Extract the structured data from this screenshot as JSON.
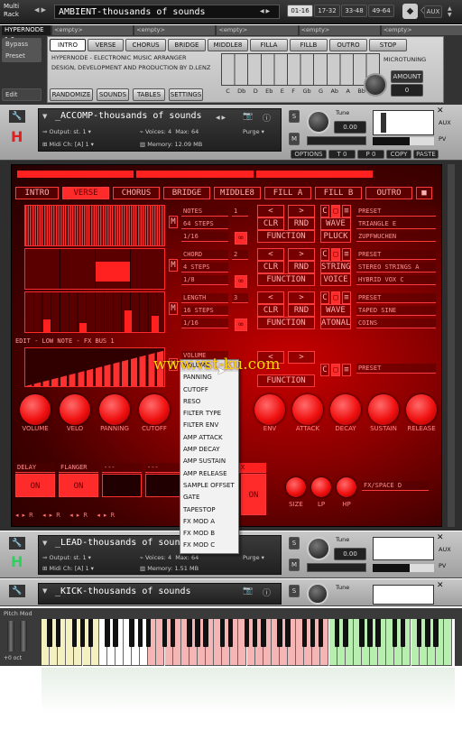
{
  "rack": {
    "multi": "Multi",
    "rack": "Rack",
    "title": "AMBIENT-thousands of sounds",
    "ranges": [
      "01-16",
      "17-32",
      "33-48",
      "49-64"
    ],
    "aux": "AUX"
  },
  "top": {
    "instrument": "HYPERNODE 1.0",
    "slots": [
      "<empty>",
      "<empty>",
      "<empty>",
      "<empty>",
      "<empty>"
    ],
    "bypass": "Bypass",
    "preset": "Preset",
    "edit": "Edit"
  },
  "hyper": {
    "tabs": [
      "INTRO",
      "VERSE",
      "CHORUS",
      "BRIDGE",
      "MIDDLE8",
      "FILLA",
      "FILLB",
      "OUTRO",
      "STOP"
    ],
    "line1": "HYPERNODE - ELECTRONIC MUSIC ARRANGER",
    "line2": "DESIGN, DEVELOPMENT AND PRODUCTION BY D.LENZ",
    "microtuning": "MICROTUNING",
    "amount": "AMOUNT",
    "amount_value": "0",
    "notes": [
      "C",
      "Db",
      "D",
      "Eb",
      "E",
      "F",
      "Gb",
      "G",
      "Ab",
      "A",
      "Bb",
      "B"
    ],
    "buttons": [
      "RANDOMIZE",
      "SOUNDS",
      "TABLES",
      "SETTINGS"
    ]
  },
  "inst1": {
    "title": "_ACCOMP-thousands of sounds",
    "output": "Output:",
    "output_val": "st. 1",
    "voices": "Voices:",
    "voices_val": "4",
    "max": "Max:",
    "max_val": "64",
    "purge": "Purge",
    "midi": "Midi Ch:",
    "midi_val": "[A]  1",
    "memory": "Memory:",
    "memory_val": "12.09 MB",
    "tune": "Tune",
    "tune_val": "0.00",
    "s": "S",
    "m": "M",
    "tabs": [
      "OPTIONS",
      "T 0",
      "P 0",
      "COPY",
      "PASTE"
    ]
  },
  "panel": {
    "sections": [
      "INTRO",
      "VERSE",
      "CHORUS",
      "BRIDGE",
      "MIDDLE8",
      "FILL A",
      "FILL B",
      "OUTRO"
    ],
    "rows": [
      {
        "sel1": "NOTES",
        "sel2": "64 STEPS",
        "sel3": "1/16",
        "num": "1",
        "b1": "CLR",
        "b2": "RND",
        "b3": "FUNCTION",
        "c1": "WAVE",
        "c2": "PLUCK",
        "p1": "PRESET",
        "p2": "TRIANGLE E",
        "p3": "ZUPFWUCHEN"
      },
      {
        "sel1": "CHORD",
        "sel2": "4 STEPS",
        "sel3": "1/8",
        "num": "2",
        "b1": "CLR",
        "b2": "RND",
        "b3": "FUNCTION",
        "c1": "STRING",
        "c2": "VOICE",
        "p1": "PRESET",
        "p2": "STEREO STRINGS A",
        "p3": "HYBRID VOX C"
      },
      {
        "sel1": "LENGTH",
        "sel2": "16 STEPS",
        "sel3": "1/16",
        "num": "3",
        "b1": "CLR",
        "b2": "RND",
        "b3": "FUNCTION",
        "c1": "WAVE",
        "c2": "ATONAL",
        "p1": "PRESET",
        "p2": "TAPED SINE",
        "p3": "COINS"
      }
    ],
    "edit_label": "EDIT - LOW NOTE - FX BUS 1",
    "vol_sel": "VOLUME",
    "vol_function": "FUNCTION",
    "vol_preset": "PRESET",
    "knobs": [
      "VOLUME",
      "VELO",
      "PANNING",
      "CUTOFF",
      "ENV",
      "ATTACK",
      "DECAY",
      "SUSTAIN",
      "RELEASE"
    ],
    "fx": [
      "DELAY",
      "FLANGER",
      "---",
      "---"
    ],
    "fx_on": "ON",
    "fx_on2": "ON",
    "fx_x": "X",
    "space": "FX/SPACE D",
    "space_knobs": [
      "SIZE",
      "LP",
      "HP"
    ]
  },
  "menu": {
    "items": [
      "VOLUME",
      "PANNING",
      "CUTOFF",
      "RESO",
      "FILTER TYPE",
      "FILTER ENV",
      "AMP ATTACK",
      "AMP DECAY",
      "AMP SUSTAIN",
      "AMP RELEASE",
      "SAMPLE OFFSET",
      "GATE",
      "TAPESTOP",
      "FX MOD A",
      "FX MOD B",
      "FX MOD C"
    ]
  },
  "watermark": "www.vst-ku.com",
  "inst2": {
    "title": "_LEAD-thousands of sounds",
    "output": "Output:",
    "output_val": "st. 1",
    "voices": "Voices:",
    "voices_val": "4",
    "max": "Max:",
    "max_val": "64",
    "purge": "Purge",
    "midi": "Midi Ch:",
    "midi_val": "[A]  1",
    "memory": "Memory:",
    "memory_val": "1.51 MB",
    "tune": "Tune",
    "tune_val": "0.00",
    "s": "S",
    "m": "M"
  },
  "inst3": {
    "title": "_KICK-thousands of sounds",
    "tune": "Tune",
    "s": "S"
  },
  "keyboard": {
    "pitch_mod": "Pitch Mod",
    "oct": "+0 oct"
  }
}
